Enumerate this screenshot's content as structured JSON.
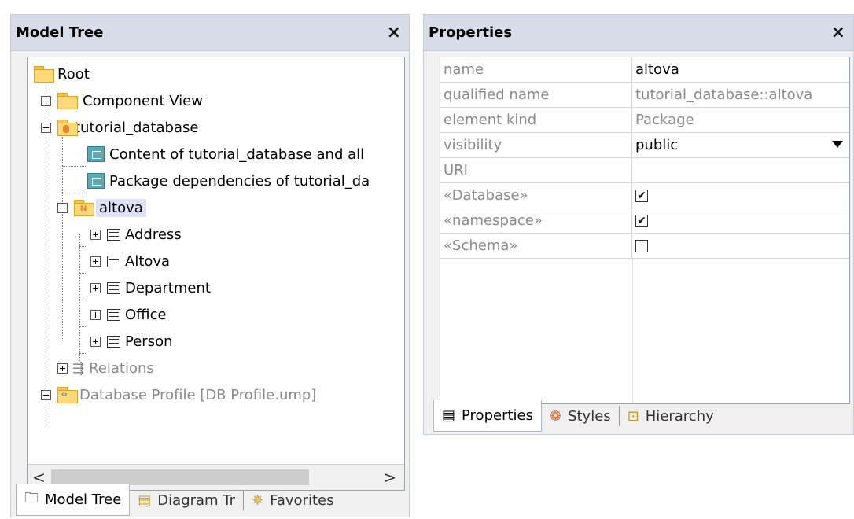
{
  "model_tree": {
    "title": "Model Tree",
    "close": "×",
    "nodes": [
      {
        "label": "Root"
      },
      {
        "label": "Component View"
      },
      {
        "label": "tutorial_database"
      },
      {
        "label": "Content of tutorial_database and all"
      },
      {
        "label": "Package dependencies of tutorial_da"
      },
      {
        "label": "altova"
      },
      {
        "label": "Address"
      },
      {
        "label": "Altova"
      },
      {
        "label": "Department"
      },
      {
        "label": "Office"
      },
      {
        "label": "Person"
      },
      {
        "label": "Relations"
      },
      {
        "label": "Database Profile [DB Profile.ump]"
      }
    ],
    "scroll_left": "<",
    "scroll_right": ">",
    "tabs": [
      {
        "label": "Model Tree",
        "icon": "folder-icon"
      },
      {
        "label": "Diagram Tr",
        "icon": "diagram-tree-icon"
      },
      {
        "label": "Favorites",
        "icon": "favorites-icon"
      }
    ]
  },
  "properties": {
    "title": "Properties",
    "close": "×",
    "rows": [
      {
        "name": "name",
        "value": "altova"
      },
      {
        "name": "qualified name",
        "value": "tutorial_database::altova"
      },
      {
        "name": "element kind",
        "value": "Package"
      },
      {
        "name": "visibility",
        "value": "public"
      },
      {
        "name": "URI",
        "value": ""
      },
      {
        "name": "«Database»",
        "checked": true
      },
      {
        "name": "«namespace»",
        "checked": true
      },
      {
        "name": "«Schema»",
        "checked": false
      }
    ],
    "tabs": [
      {
        "label": "Properties",
        "icon": "properties-icon"
      },
      {
        "label": "Styles",
        "icon": "palette-icon"
      },
      {
        "label": "Hierarchy",
        "icon": "hierarchy-icon"
      }
    ]
  },
  "colors": {
    "header_bg": "#d6dde9",
    "selection_bg": "#dfe1fb",
    "folder_yellow": "#fbd97a",
    "teal_icon": "#5aa9b8"
  }
}
